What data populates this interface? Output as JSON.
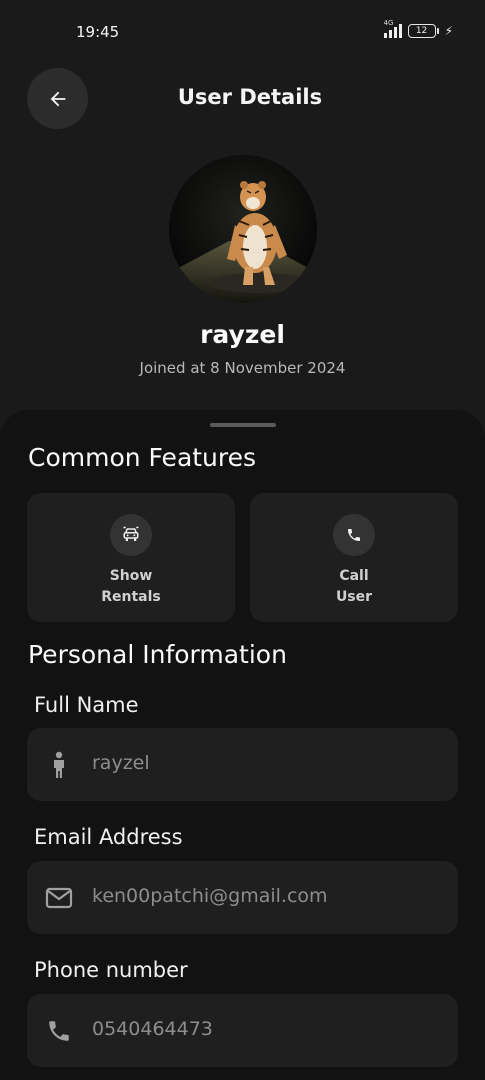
{
  "status_bar": {
    "time": "19:45",
    "network": "4G",
    "battery": "12"
  },
  "header": {
    "title": "User Details",
    "back_icon": "arrow-left-icon"
  },
  "profile": {
    "username": "rayzel",
    "joined": "Joined at 8 November 2024",
    "avatar": "tiger-avatar"
  },
  "common_features": {
    "title": "Common Features",
    "items": [
      {
        "line1": "Show",
        "line2": "Rentals",
        "icon": "car-icon"
      },
      {
        "line1": "Call",
        "line2": "User",
        "icon": "phone-icon"
      }
    ]
  },
  "personal_info": {
    "title": "Personal Information",
    "fields": [
      {
        "label": "Full Name",
        "value": "rayzel",
        "icon": "person-icon"
      },
      {
        "label": "Email Address",
        "value": "ken00patchi@gmail.com",
        "icon": "mail-icon"
      },
      {
        "label": "Phone number",
        "value": "0540464473",
        "icon": "phone-icon"
      }
    ]
  },
  "colors": {
    "background": "#1a1a1a",
    "sheet": "#121212",
    "card": "#1f1f1f",
    "text_primary": "#fafafa",
    "text_muted": "#8d8d8d"
  }
}
